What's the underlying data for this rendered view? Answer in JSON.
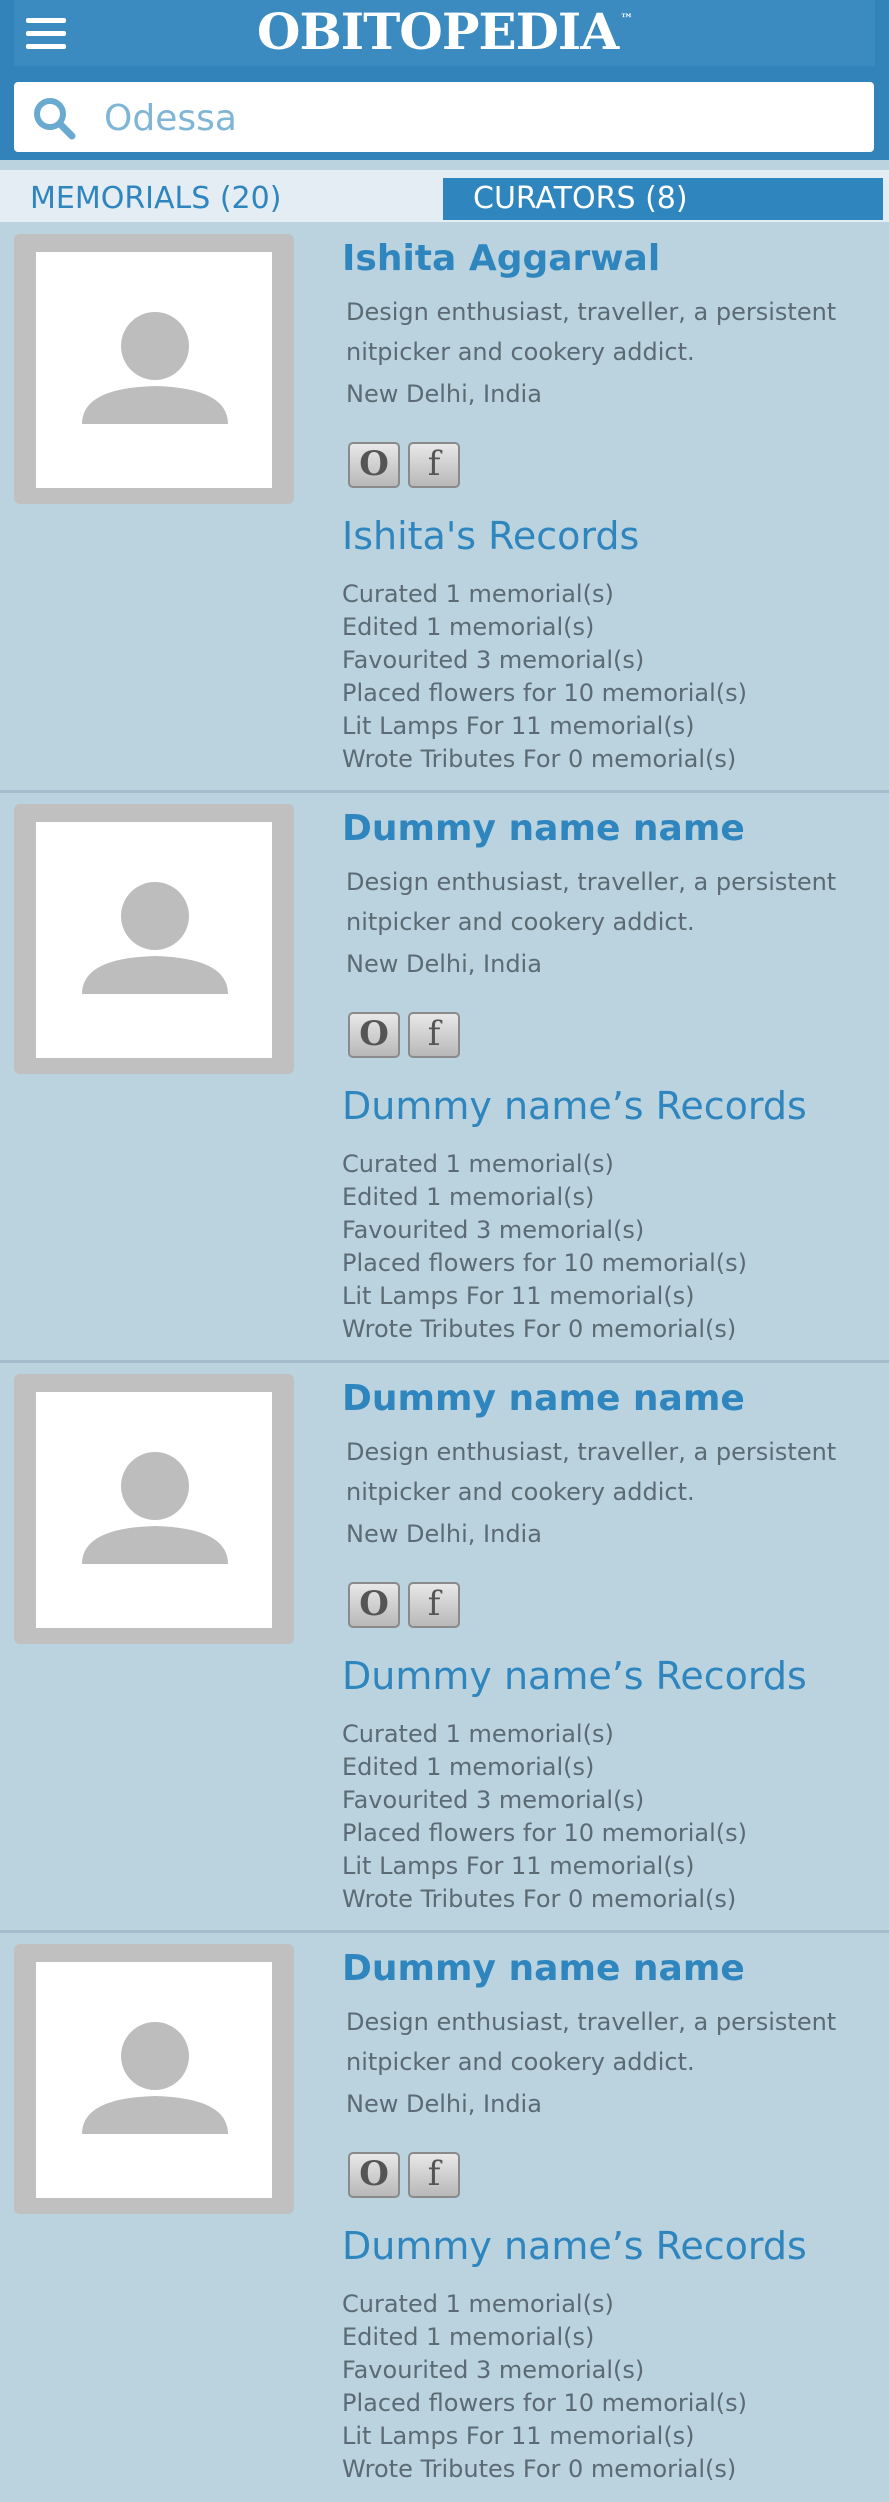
{
  "header": {
    "logo_text": "OBITOPEDIA",
    "trademark": "™",
    "menu_icon": "hamburger-menu-icon"
  },
  "search": {
    "icon": "search-icon",
    "value": "",
    "placeholder": "Odessa"
  },
  "tabs": {
    "memorials_label": "MEMORIALS (20)",
    "curators_label": "CURATORS (8)",
    "active": "curators"
  },
  "colors": {
    "brand_blue": "#2f85bd",
    "page_bg": "#bad3df",
    "text_gray": "#5c6b73"
  },
  "curators": [
    {
      "name": "Ishita Aggarwal",
      "bio": "Design enthusiast, traveller, a persistent nitpicker and cookery addict.",
      "location": "New Delhi, India",
      "social_o": "O",
      "social_f": "f",
      "records_title": "Ishita's Records",
      "records": [
        "Curated 1 memorial(s)",
        "Edited 1 memorial(s)",
        "Favourited 3 memorial(s)",
        "Placed flowers for 10 memorial(s)",
        "Lit Lamps For 11 memorial(s)",
        "Wrote Tributes For 0 memorial(s)"
      ]
    },
    {
      "name": "Dummy name name",
      "bio": "Design enthusiast, traveller, a persistent nitpicker and cookery addict.",
      "location": "New Delhi, India",
      "social_o": "O",
      "social_f": "f",
      "records_title": "Dummy name’s Records",
      "records": [
        "Curated 1 memorial(s)",
        "Edited 1 memorial(s)",
        "Favourited 3 memorial(s)",
        "Placed flowers for 10 memorial(s)",
        "Lit Lamps For 11 memorial(s)",
        "Wrote Tributes For 0 memorial(s)"
      ]
    },
    {
      "name": "Dummy name name",
      "bio": "Design enthusiast, traveller, a persistent nitpicker and cookery addict.",
      "location": "New Delhi, India",
      "social_o": "O",
      "social_f": "f",
      "records_title": "Dummy name’s Records",
      "records": [
        "Curated 1 memorial(s)",
        "Edited 1 memorial(s)",
        "Favourited 3 memorial(s)",
        "Placed flowers for 10 memorial(s)",
        "Lit Lamps For 11 memorial(s)",
        "Wrote Tributes For 0 memorial(s)"
      ]
    },
    {
      "name": "Dummy name name",
      "bio": "Design enthusiast, traveller, a persistent nitpicker and cookery addict.",
      "location": "New Delhi, India",
      "social_o": "O",
      "social_f": "f",
      "records_title": "Dummy name’s Records",
      "records": [
        "Curated 1 memorial(s)",
        "Edited 1 memorial(s)",
        "Favourited 3 memorial(s)",
        "Placed flowers for 10 memorial(s)",
        "Lit Lamps For 11 memorial(s)",
        "Wrote Tributes For 0 memorial(s)"
      ]
    }
  ]
}
